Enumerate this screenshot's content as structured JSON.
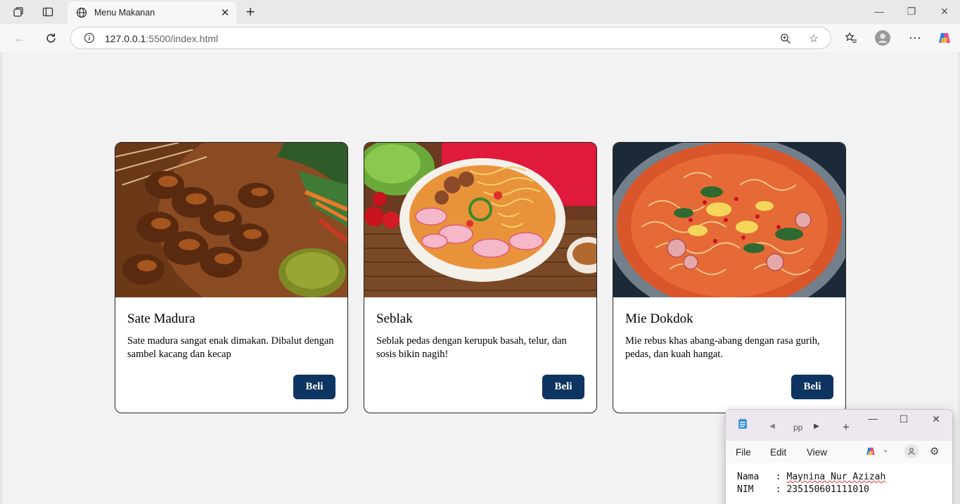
{
  "browser": {
    "tab_title": "Menu Makanan",
    "url_host": "127.0.0.1",
    "url_rest": ":5500/index.html"
  },
  "menu": {
    "cards": [
      {
        "name": "Sate Madura",
        "description": "Sate madura sangat enak dimakan. Dibalut dengan sambel kacang dan kecap",
        "button": "Beli"
      },
      {
        "name": "Seblak",
        "description": "Seblak pedas dengan kerupuk basah, telur, dan sosis bikin nagih!",
        "button": "Beli"
      },
      {
        "name": "Mie Dokdok",
        "description": "Mie rebus khas abang-abang dengan rasa gurih, pedas, dan kuah hangat.",
        "button": "Beli"
      }
    ],
    "button_color": "#0e3461"
  },
  "notepad": {
    "tab_label": "pp",
    "menus": [
      "File",
      "Edit",
      "View"
    ],
    "lines": [
      {
        "label": "Nama  ",
        "separator": " : ",
        "value": "Maynina Nur Azizah"
      },
      {
        "label": "NIM   ",
        "separator": " : ",
        "value": "235150601111010"
      }
    ]
  }
}
